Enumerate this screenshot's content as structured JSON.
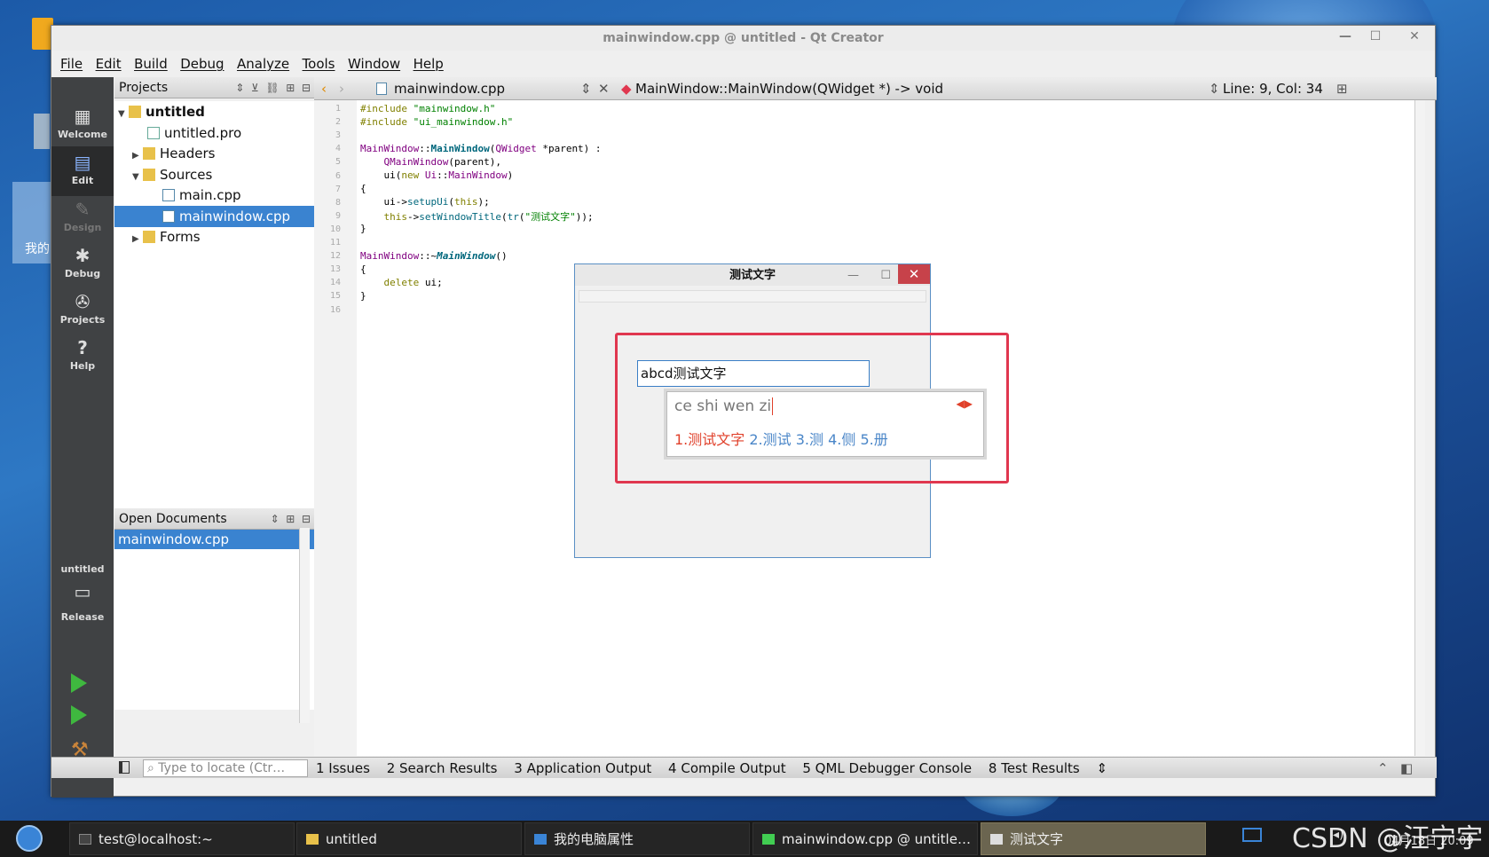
{
  "window": {
    "title": "mainwindow.cpp @ untitled - Qt Creator",
    "minimize": "—",
    "maximize": "☐",
    "close": "✕"
  },
  "menu": [
    "File",
    "Edit",
    "Build",
    "Debug",
    "Analyze",
    "Tools",
    "Window",
    "Help"
  ],
  "modes": {
    "welcome": "Welcome",
    "edit": "Edit",
    "design": "Design",
    "debug": "Debug",
    "projects": "Projects",
    "help": "Help"
  },
  "kit": {
    "project": "untitled",
    "build": "Release"
  },
  "projects_panel": {
    "title": "Projects",
    "items": [
      "untitled",
      "untitled.pro",
      "Headers",
      "Sources",
      "main.cpp",
      "mainwindow.cpp",
      "Forms"
    ]
  },
  "open_documents": {
    "title": "Open Documents",
    "items": [
      "mainwindow.cpp"
    ]
  },
  "editor": {
    "file": "mainwindow.cpp",
    "symbol": "MainWindow::MainWindow(QWidget *) -> void",
    "position": "Line: 9, Col: 34",
    "line_numbers": [
      "1",
      "2",
      "3",
      "4",
      "5",
      "6",
      "7",
      "8",
      "9",
      "10",
      "11",
      "12",
      "13",
      "14",
      "15",
      "16"
    ]
  },
  "statusbar": {
    "locate_placeholder": "Type to locate (Ctr…",
    "tabs": [
      "1 Issues",
      "2 Search Results",
      "3 Application Output",
      "4 Compile Output",
      "5 QML Debugger Console",
      "8 Test Results"
    ]
  },
  "dialog": {
    "title": "测试文字",
    "input_value": "abcd测试文字",
    "ime_pinyin": "ce shi wen zi",
    "ime_candidates": [
      "1.测试文字",
      "2.测试",
      "3.测",
      "4.侧",
      "5.册"
    ]
  },
  "desktop": {
    "icon_label": "我的"
  },
  "taskbar": {
    "tasks": [
      "test@localhost:~",
      "untitled",
      "我的电脑属性",
      "mainwindow.cpp @ untitle…",
      "测试文字"
    ],
    "clock": "04月18日 20:09",
    "watermark": "CSDN @汪宁宇"
  },
  "colors": {
    "selection": "#3a83d0",
    "mode_bar": "#404244",
    "highlight_box": "#e0374f",
    "ime_first": "#e0402a",
    "ime_other": "#4a86c8"
  }
}
